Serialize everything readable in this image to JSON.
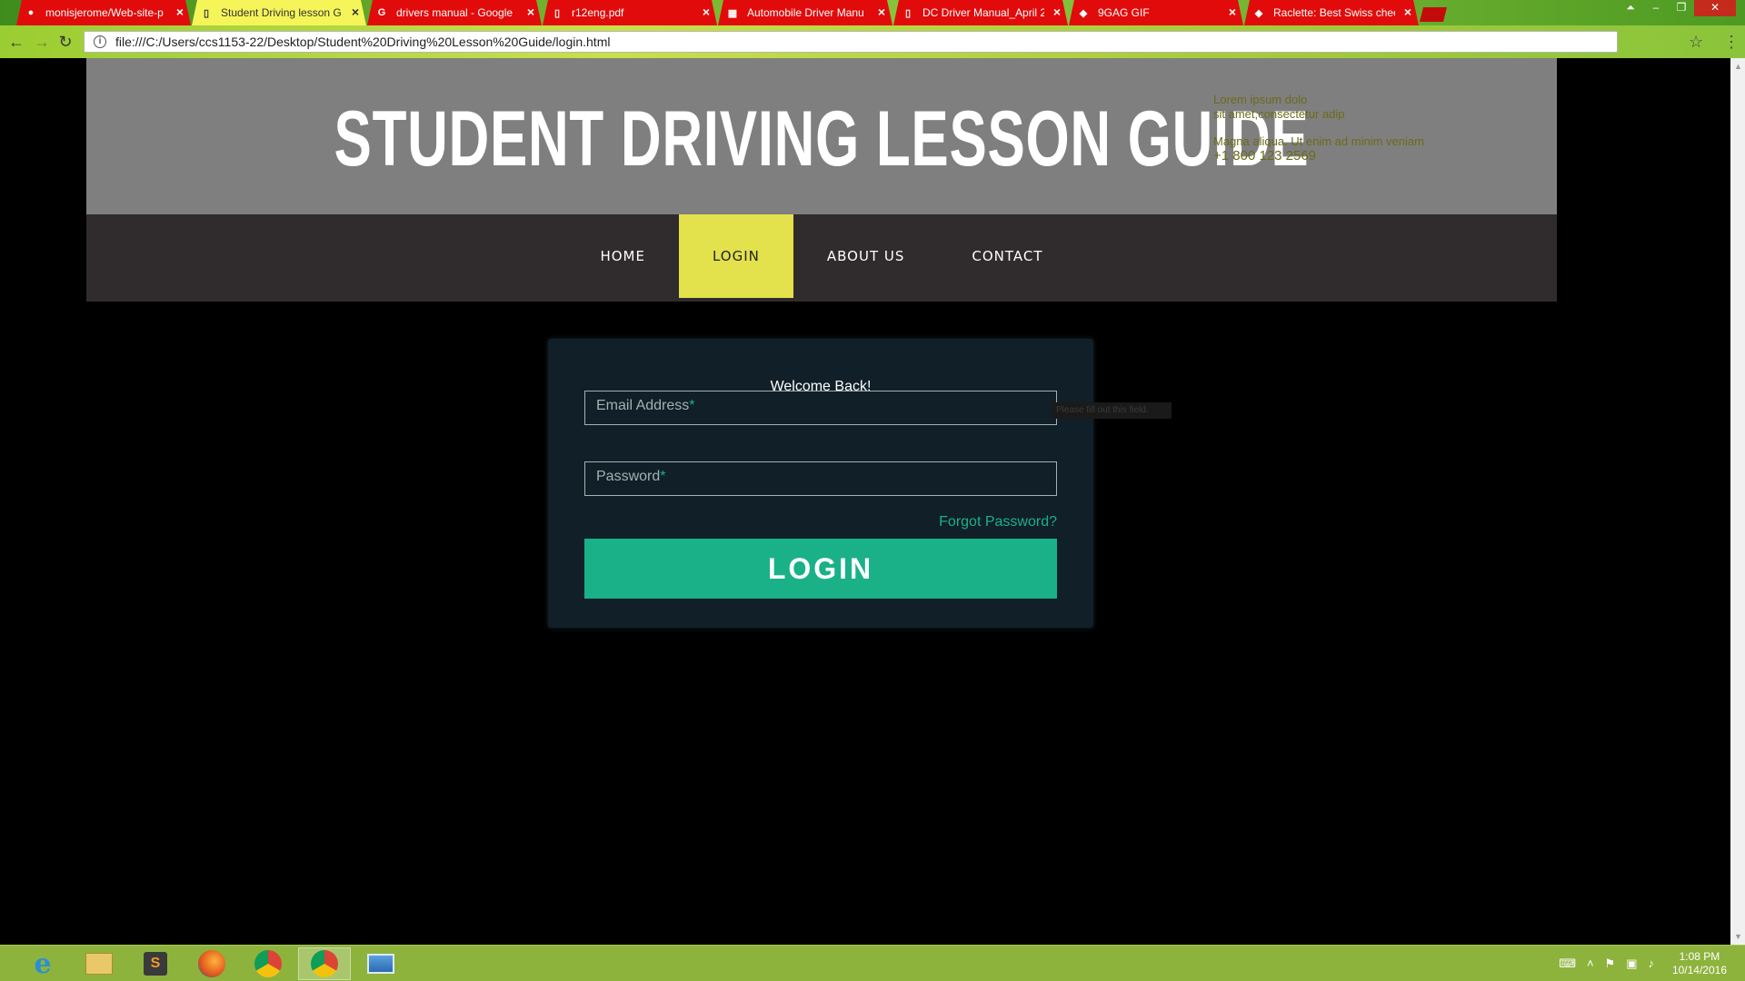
{
  "browser": {
    "tabs": [
      {
        "label": "monisjerome/Web-site-p",
        "icon": "github-icon",
        "active": false
      },
      {
        "label": "Student Driving lesson G",
        "icon": "document-icon",
        "active": true
      },
      {
        "label": "drivers manual - Google",
        "icon": "google-icon",
        "active": false
      },
      {
        "label": "r12eng.pdf",
        "icon": "pdf-icon",
        "active": false
      },
      {
        "label": "Automobile Driver Manu",
        "icon": "film-icon",
        "active": false
      },
      {
        "label": "DC Driver Manual_April 2",
        "icon": "pdf-icon",
        "active": false
      },
      {
        "label": "9GAG GIF",
        "icon": "9gag-icon",
        "active": false
      },
      {
        "label": "Raclette: Best Swiss chee",
        "icon": "site-icon",
        "active": false
      }
    ],
    "url": "file:///C:/Users/ccs1153-22/Desktop/Student%20Driving%20Lesson%20Guide/login.html"
  },
  "header": {
    "title": "STUDENT DRIVING LESSON GUIDE",
    "contact_lines": [
      "Lorem ipsum dolo",
      "sit amet,consectetur adip"
    ],
    "contact_lines2": [
      "Magna aliqua. Ut enim ad minim veniam",
      "+1 800 123 2569"
    ]
  },
  "nav": {
    "items": [
      {
        "label": "HOME",
        "active": false
      },
      {
        "label": "LOGIN",
        "active": true
      },
      {
        "label": "ABOUT US",
        "active": false
      },
      {
        "label": "CONTACT",
        "active": false
      }
    ]
  },
  "login": {
    "welcome": "Welcome Back!",
    "email_placeholder": "Email Address",
    "password_placeholder": "Password",
    "required_mark": "*",
    "tooltip": "Please fill out this field.",
    "forgot": "Forgot Password?",
    "button": "LOGIN"
  },
  "taskbar": {
    "time": "1:08 PM",
    "date": "10/14/2016"
  },
  "colors": {
    "accent": "#1ab188",
    "nav_active": "#e3e14c",
    "header_bg": "#7f7f7f",
    "nav_bg": "#302b2c",
    "card_bg": "#111f28"
  }
}
